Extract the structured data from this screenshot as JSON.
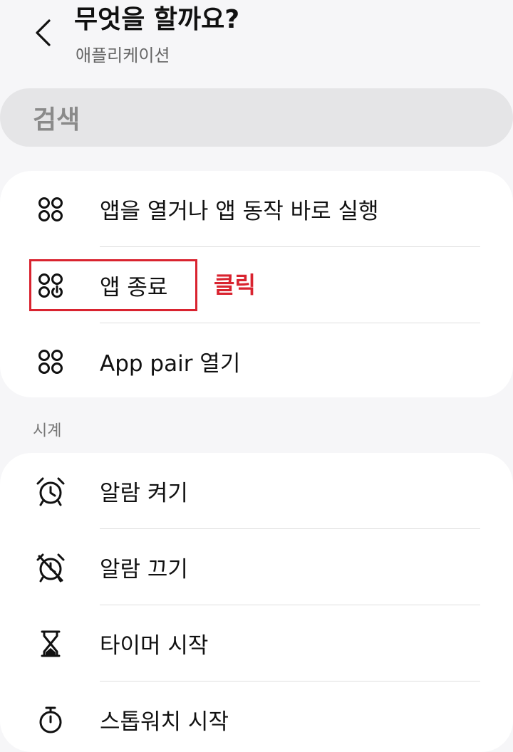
{
  "header": {
    "title": "무엇을 할까요?",
    "subtitle": "애플리케이션"
  },
  "search": {
    "placeholder": "검색"
  },
  "apps_section": {
    "items": [
      {
        "icon": "apps-icon",
        "label": "앱을 열거나 앱 동작 바로 실행"
      },
      {
        "icon": "apps-power-icon",
        "label": "앱 종료"
      },
      {
        "icon": "apps-icon",
        "label": "App pair 열기"
      }
    ]
  },
  "clock_section": {
    "title": "시계",
    "items": [
      {
        "icon": "alarm-clock-icon",
        "label": "알람 켜기"
      },
      {
        "icon": "alarm-off-icon",
        "label": "알람 끄기"
      },
      {
        "icon": "hourglass-icon",
        "label": "타이머 시작"
      },
      {
        "icon": "stopwatch-icon",
        "label": "스톱워치 시작"
      }
    ]
  },
  "annotation": {
    "text": "클릭",
    "color": "#d9232f"
  }
}
